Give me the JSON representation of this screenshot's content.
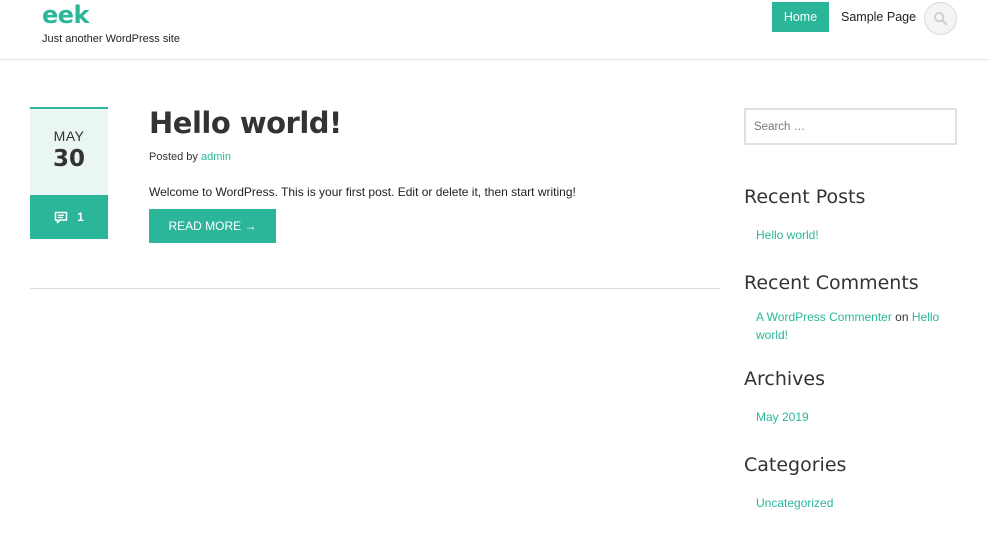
{
  "site": {
    "title": "eek",
    "tagline": "Just another WordPress site"
  },
  "nav": {
    "home": "Home",
    "sample_page": "Sample Page"
  },
  "post": {
    "month": "MAY",
    "day": "30",
    "comment_count": "1",
    "title": "Hello world!",
    "posted_by_label": "Posted by",
    "author": "admin",
    "excerpt": "Welcome to WordPress. This is your first post. Edit or delete it, then start writing!",
    "read_more": "READ MORE →"
  },
  "sidebar": {
    "search_placeholder": "Search …",
    "recent_posts_title": "Recent Posts",
    "recent_posts": [
      "Hello world!"
    ],
    "recent_comments_title": "Recent Comments",
    "comment": {
      "author": "A WordPress Commenter",
      "on": "on",
      "post_line1": "Hello",
      "post_line2": "world!"
    },
    "archives_title": "Archives",
    "archives": [
      "May 2019"
    ],
    "categories_title": "Categories",
    "categories": [
      "Uncategorized"
    ]
  },
  "colors": {
    "accent": "#2bb69a",
    "date_bg": "#eaf6f4"
  }
}
